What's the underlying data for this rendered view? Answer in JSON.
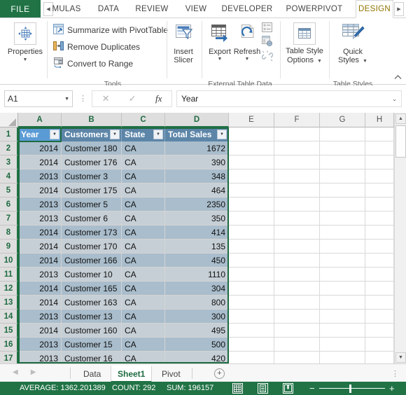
{
  "ribbon_tabs": {
    "file_label": "FILE",
    "scroll_left_icon": "chevron-left-icon",
    "scroll_right_icon": "chevron-right-icon",
    "items": [
      {
        "label": "MULAS",
        "clipped": true
      },
      {
        "label": "DATA"
      },
      {
        "label": "REVIEW"
      },
      {
        "label": "VIEW"
      },
      {
        "label": "DEVELOPER"
      },
      {
        "label": "POWERPIVOT"
      },
      {
        "label": "DESIGN",
        "active": true
      }
    ]
  },
  "ribbon": {
    "properties": {
      "label": "Properties",
      "icon": "table-properties-icon",
      "caret": "▼"
    },
    "tools": {
      "group_label": "Tools",
      "items": [
        {
          "label": "Summarize with PivotTable",
          "icon": "pivottable-icon"
        },
        {
          "label": "Remove Duplicates",
          "icon": "remove-duplicates-icon"
        },
        {
          "label": "Convert to Range",
          "icon": "convert-to-range-icon"
        }
      ]
    },
    "insert_slicer": {
      "label_line1": "Insert",
      "label_line2": "Slicer",
      "icon": "slicer-icon"
    },
    "external_table_data": {
      "group_label": "External Table Data",
      "export": {
        "label": "Export",
        "icon": "export-icon",
        "caret": "▼"
      },
      "refresh": {
        "label": "Refresh",
        "icon": "refresh-icon",
        "caret": "▼"
      },
      "small_icons": [
        {
          "name": "properties-small-icon"
        },
        {
          "name": "open-in-browser-icon"
        },
        {
          "name": "unlink-icon"
        }
      ]
    },
    "table_styles": {
      "group_label": "Table Styles",
      "table_style_options": {
        "label_line1": "Table Style",
        "label_line2": "Options",
        "icon": "table-style-options-icon",
        "caret": "▼"
      },
      "quick_styles": {
        "label_line1": "Quick",
        "label_line2": "Styles",
        "icon": "quick-styles-icon",
        "caret": "▼"
      }
    },
    "collapse_icon": "chevron-up-icon"
  },
  "formula_bar": {
    "name_box_value": "A1",
    "name_box_caret": "▼",
    "cancel_icon": "✕",
    "enter_icon": "✓",
    "function_icon": "fx",
    "formula_value": "Year",
    "expand_caret": "⌄",
    "menu_dots": "⋮"
  },
  "grid": {
    "column_headers": [
      "A",
      "B",
      "C",
      "D",
      "E",
      "F",
      "G",
      "H"
    ],
    "selected_columns": [
      "A",
      "B",
      "C",
      "D"
    ],
    "row_numbers": [
      "1",
      "2",
      "3",
      "4",
      "5",
      "6",
      "7",
      "8",
      "9",
      "10",
      "11",
      "12",
      "13",
      "14",
      "15",
      "16",
      "17"
    ],
    "selected_rows": [
      "1",
      "2",
      "3",
      "4",
      "5",
      "6",
      "7",
      "8",
      "9",
      "10",
      "11",
      "12",
      "13",
      "14",
      "15",
      "16",
      "17"
    ],
    "table_headers": [
      "Year",
      "Customers",
      "State",
      "Total Sales"
    ],
    "filter_icon": "▼",
    "rows": [
      {
        "year": "2014",
        "customer": "Customer 180",
        "state": "CA",
        "sales": "1672"
      },
      {
        "year": "2014",
        "customer": "Customer 176",
        "state": "CA",
        "sales": "390"
      },
      {
        "year": "2013",
        "customer": "Customer 3",
        "state": "CA",
        "sales": "348"
      },
      {
        "year": "2014",
        "customer": "Customer 175",
        "state": "CA",
        "sales": "464"
      },
      {
        "year": "2013",
        "customer": "Customer 5",
        "state": "CA",
        "sales": "2350"
      },
      {
        "year": "2013",
        "customer": "Customer 6",
        "state": "CA",
        "sales": "350"
      },
      {
        "year": "2014",
        "customer": "Customer 173",
        "state": "CA",
        "sales": "414"
      },
      {
        "year": "2014",
        "customer": "Customer 170",
        "state": "CA",
        "sales": "135"
      },
      {
        "year": "2014",
        "customer": "Customer 166",
        "state": "CA",
        "sales": "450"
      },
      {
        "year": "2013",
        "customer": "Customer 10",
        "state": "CA",
        "sales": "1110"
      },
      {
        "year": "2014",
        "customer": "Customer 165",
        "state": "CA",
        "sales": "304"
      },
      {
        "year": "2014",
        "customer": "Customer 163",
        "state": "CA",
        "sales": "800"
      },
      {
        "year": "2013",
        "customer": "Customer 13",
        "state": "CA",
        "sales": "300"
      },
      {
        "year": "2014",
        "customer": "Customer 160",
        "state": "CA",
        "sales": "495"
      },
      {
        "year": "2013",
        "customer": "Customer 15",
        "state": "CA",
        "sales": "500"
      },
      {
        "year": "2013",
        "customer": "Customer 16",
        "state": "CA",
        "sales": "420"
      }
    ],
    "scrollbar": {
      "up_icon": "▲",
      "down_icon": "▼"
    }
  },
  "sheet_tabs": {
    "prev_icon": "◀",
    "next_icon": "▶",
    "items": [
      {
        "label": "Data"
      },
      {
        "label": "Sheet1",
        "active": true
      },
      {
        "label": "Pivot"
      }
    ],
    "add_sheet_label": "+",
    "menu_dots": "⋮"
  },
  "status_bar": {
    "average": "AVERAGE: 1362.201389",
    "count": "COUNT: 292",
    "sum": "SUM: 196157",
    "view_buttons": [
      {
        "name": "normal-view-button",
        "glyph": "▦",
        "active": true
      },
      {
        "name": "page-layout-view-button",
        "glyph": "▤",
        "active": false
      },
      {
        "name": "page-break-preview-button",
        "glyph": "◫",
        "active": false
      }
    ],
    "zoom_out_label": "−",
    "zoom_in_label": "+"
  },
  "colors": {
    "excel_green": "#217346",
    "table_header_blue": "#5c85a8",
    "active_cell_blue": "#5b9bd5",
    "band_light": "#c6cfd6",
    "band_dark": "#a9bdcc",
    "active_tab_text": "#8f7400"
  }
}
